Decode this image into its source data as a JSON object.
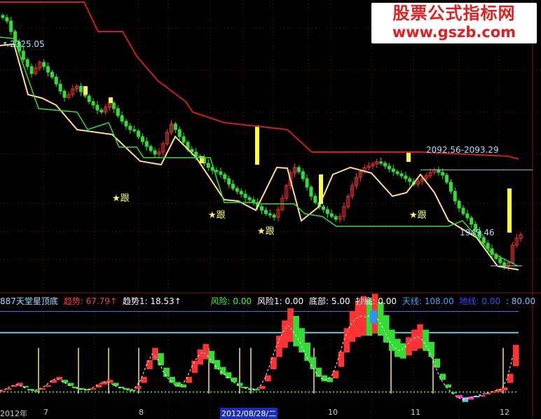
{
  "watermark": {
    "line1": "股票公式指标网",
    "line2": "www.gszb.com"
  },
  "annotations": {
    "high": "2325.05",
    "range": "2092.56-2093.29",
    "low": "1949.46",
    "star_label": "★跟"
  },
  "indicator_bar": {
    "name": "887天堂星顶底",
    "items": [
      {
        "text": "趋势: 67.79↑",
        "color": "#ff4040"
      },
      {
        "text": "趋势1: 18.53↑",
        "color": "#ffffff"
      },
      {
        "text": "风险: 0.00",
        "color": "#40ff40"
      },
      {
        "text": "风险1: 0.00",
        "color": "#ffffff"
      },
      {
        "text": "底部: 5.00",
        "color": "#ffffff"
      },
      {
        "text": "抄底: 0.00",
        "color": "#ffffff"
      },
      {
        "text": "天线: 108.00",
        "color": "#40a0ff"
      },
      {
        "text": "地线: 0.00",
        "color": "#3050ff"
      },
      {
        "text": ": 80.00",
        "color": "#80c0ff"
      }
    ]
  },
  "x_axis": {
    "labels": [
      "2012年",
      "7",
      "8",
      "10",
      "11",
      "12"
    ],
    "cursor_date": "2012/08/28/二"
  },
  "colors": {
    "up": "#ff3333",
    "down": "#33dd33",
    "yellow": "#ffff40",
    "pale_yellow": "#ffe080",
    "red_line": "#cc1f1f",
    "green_line": "#33dd33",
    "cyan": "#66ccdd",
    "magenta": "#ff33cc",
    "grid": "#7a1a1a"
  },
  "chart_data": {
    "type": "candlestick",
    "ylim": [
      1935,
      2335
    ],
    "high_value": 2325.05,
    "low_value": 1949.46,
    "range_low": 2092.56,
    "range_high": 2093.29,
    "closes": [
      2310,
      2305,
      2290,
      2275,
      2262,
      2250,
      2240,
      2230,
      2238,
      2246,
      2240,
      2232,
      2225,
      2215,
      2205,
      2196,
      2200,
      2208,
      2212,
      2204,
      2198,
      2190,
      2185,
      2178,
      2175,
      2182,
      2188,
      2180,
      2170,
      2162,
      2155,
      2150,
      2148,
      2140,
      2133,
      2126,
      2120,
      2115,
      2118,
      2130,
      2146,
      2158,
      2150,
      2140,
      2132,
      2122,
      2118,
      2112,
      2110,
      2102,
      2096,
      2092,
      2090,
      2086,
      2080,
      2072,
      2066,
      2062,
      2058,
      2053,
      2050,
      2046,
      2040,
      2035,
      2030,
      2028,
      2025,
      2036,
      2052,
      2070,
      2088,
      2096,
      2090,
      2080,
      2068,
      2055,
      2046,
      2040,
      2036,
      2030,
      2026,
      2022,
      2026,
      2040,
      2055,
      2070,
      2082,
      2090,
      2096,
      2098,
      2101,
      2104,
      2102,
      2098,
      2094,
      2090,
      2087,
      2084,
      2080,
      2076,
      2072,
      2076,
      2080,
      2084,
      2089,
      2093,
      2089,
      2085,
      2075,
      2062,
      2048,
      2038,
      2030,
      2024,
      2015,
      2005,
      1996,
      1988,
      1980,
      1972,
      1966,
      1960,
      1955,
      1960,
      1985,
      1995,
      2000
    ],
    "red_line": [
      [
        0,
        2332
      ],
      [
        120,
        2332
      ],
      [
        140,
        2290
      ],
      [
        175,
        2290
      ],
      [
        195,
        2255
      ],
      [
        225,
        2220
      ],
      [
        265,
        2190
      ],
      [
        275,
        2175
      ],
      [
        320,
        2160
      ],
      [
        410,
        2150
      ],
      [
        445,
        2118
      ],
      [
        520,
        2118
      ],
      [
        600,
        2118
      ],
      [
        725,
        2112
      ],
      [
        740,
        2108
      ]
    ],
    "yellow_line": [
      [
        0,
        2270
      ],
      [
        20,
        2272
      ],
      [
        40,
        2200
      ],
      [
        60,
        2195
      ],
      [
        80,
        2185
      ],
      [
        110,
        2150
      ],
      [
        160,
        2143
      ],
      [
        200,
        2105
      ],
      [
        230,
        2100
      ],
      [
        250,
        2140
      ],
      [
        280,
        2110
      ],
      [
        320,
        2050
      ],
      [
        340,
        2048
      ],
      [
        365,
        2035
      ],
      [
        395,
        2096
      ],
      [
        410,
        2095
      ],
      [
        430,
        2020
      ],
      [
        455,
        2040
      ],
      [
        475,
        2086
      ],
      [
        500,
        2096
      ],
      [
        530,
        2088
      ],
      [
        560,
        2055
      ],
      [
        580,
        2060
      ],
      [
        600,
        2086
      ],
      [
        620,
        2060
      ],
      [
        640,
        2020
      ],
      [
        680,
        1996
      ],
      [
        710,
        1955
      ],
      [
        740,
        1950
      ]
    ],
    "green_line": [
      [
        0,
        2282
      ],
      [
        20,
        2280
      ],
      [
        55,
        2180
      ],
      [
        110,
        2175
      ],
      [
        125,
        2150
      ],
      [
        155,
        2160
      ],
      [
        170,
        2125
      ],
      [
        195,
        2125
      ],
      [
        205,
        2110
      ],
      [
        300,
        2110
      ],
      [
        320,
        2046
      ],
      [
        360,
        2046
      ],
      [
        370,
        2044
      ],
      [
        420,
        2044
      ],
      [
        435,
        2030
      ],
      [
        460,
        2026
      ],
      [
        480,
        2012
      ],
      [
        640,
        2012
      ],
      [
        660,
        2020
      ],
      [
        700,
        1975
      ],
      [
        740,
        1955
      ]
    ],
    "sub_indicator": {
      "ylim": [
        -15,
        112
      ],
      "upper_line": 108,
      "cyan_line": 80,
      "dotted_line": 2,
      "spikes_x": [
        55,
        112,
        155,
        198,
        298,
        342,
        358,
        448,
        558,
        618,
        718
      ],
      "trend": [
        4,
        6,
        10,
        12,
        9,
        5,
        4,
        6,
        10,
        16,
        20,
        16,
        12,
        8,
        6,
        5,
        6,
        10,
        14,
        16,
        12,
        8,
        6,
        4,
        8,
        18,
        38,
        52,
        45,
        28,
        18,
        12,
        10,
        18,
        35,
        48,
        55,
        48,
        38,
        30,
        24,
        18,
        12,
        8,
        6,
        5,
        8,
        20,
        40,
        62,
        78,
        90,
        82,
        70,
        55,
        40,
        28,
        20,
        18,
        25,
        45,
        70,
        88,
        98,
        102,
        100,
        105,
        98,
        85,
        70,
        60,
        56,
        62,
        70,
        75,
        70,
        58,
        40,
        22,
        10,
        2,
        -4,
        -8,
        -6,
        -4,
        -2,
        0,
        2,
        4,
        6,
        20,
        50
      ],
      "trend_offset": [
        0,
        1,
        1,
        2,
        1,
        1,
        0,
        1,
        1,
        2,
        2,
        2,
        2,
        1,
        1,
        1,
        1,
        2,
        2,
        2,
        2,
        1,
        1,
        1,
        2,
        4,
        6,
        8,
        8,
        6,
        4,
        3,
        2,
        4,
        8,
        10,
        10,
        8,
        6,
        5,
        4,
        3,
        2,
        1,
        1,
        1,
        2,
        4,
        8,
        14,
        18,
        22,
        20,
        16,
        12,
        8,
        6,
        4,
        3,
        5,
        10,
        16,
        20,
        24,
        26,
        24,
        26,
        22,
        18,
        14,
        12,
        10,
        12,
        14,
        16,
        14,
        10,
        6,
        4,
        2,
        0,
        -2,
        -3,
        -2,
        -1,
        0,
        1,
        1,
        2,
        2,
        6,
        14
      ]
    }
  }
}
